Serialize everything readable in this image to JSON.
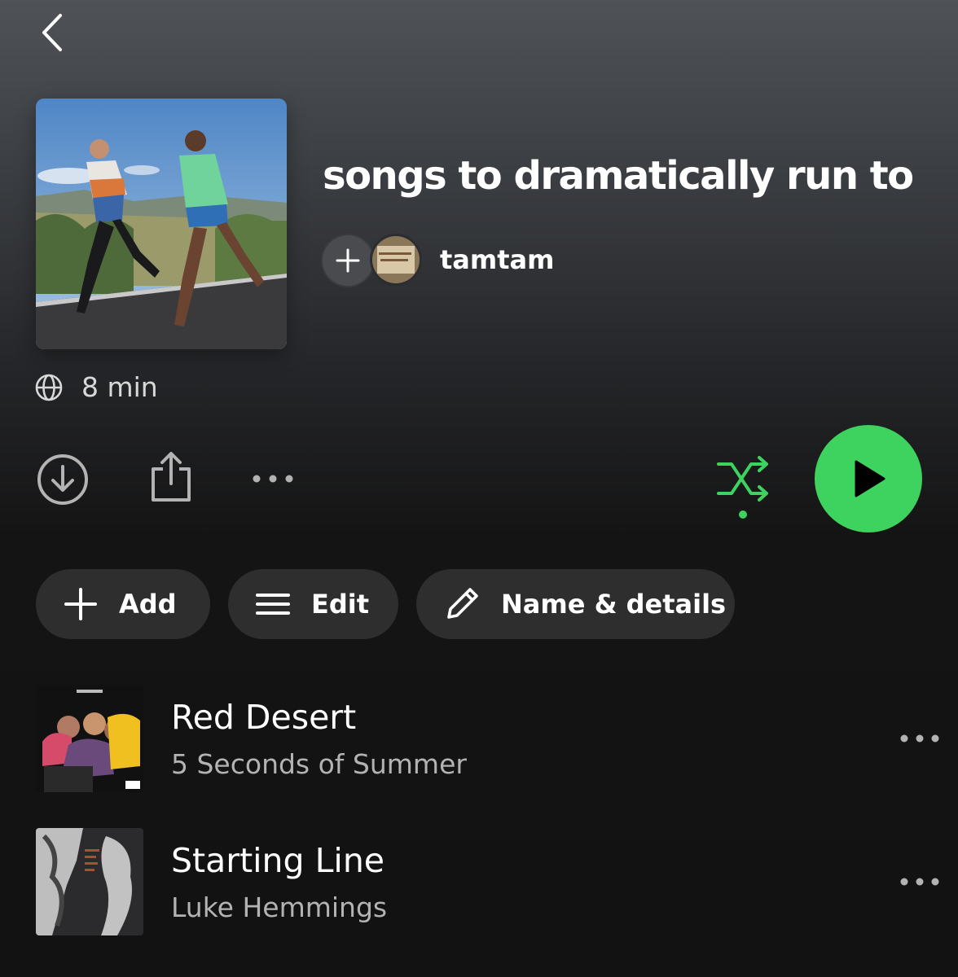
{
  "header": {
    "back_icon": "chevron-left-icon"
  },
  "playlist": {
    "title": "songs to dramatically run to",
    "owner": "tamtam",
    "visibility_icon": "globe-icon",
    "duration": "8 min"
  },
  "actions": {
    "download_icon": "download-circle-icon",
    "share_icon": "share-icon",
    "more_icon": "more-horizontal-icon",
    "shuffle_icon": "shuffle-icon",
    "play_icon": "play-icon",
    "accent_color": "#3ed35e"
  },
  "chips": {
    "add_label": "Add",
    "edit_label": "Edit",
    "details_label": "Name & details"
  },
  "tracks": [
    {
      "title": "Red Desert",
      "artist": "5 Seconds of Summer"
    },
    {
      "title": "Starting Line",
      "artist": "Luke Hemmings"
    }
  ]
}
